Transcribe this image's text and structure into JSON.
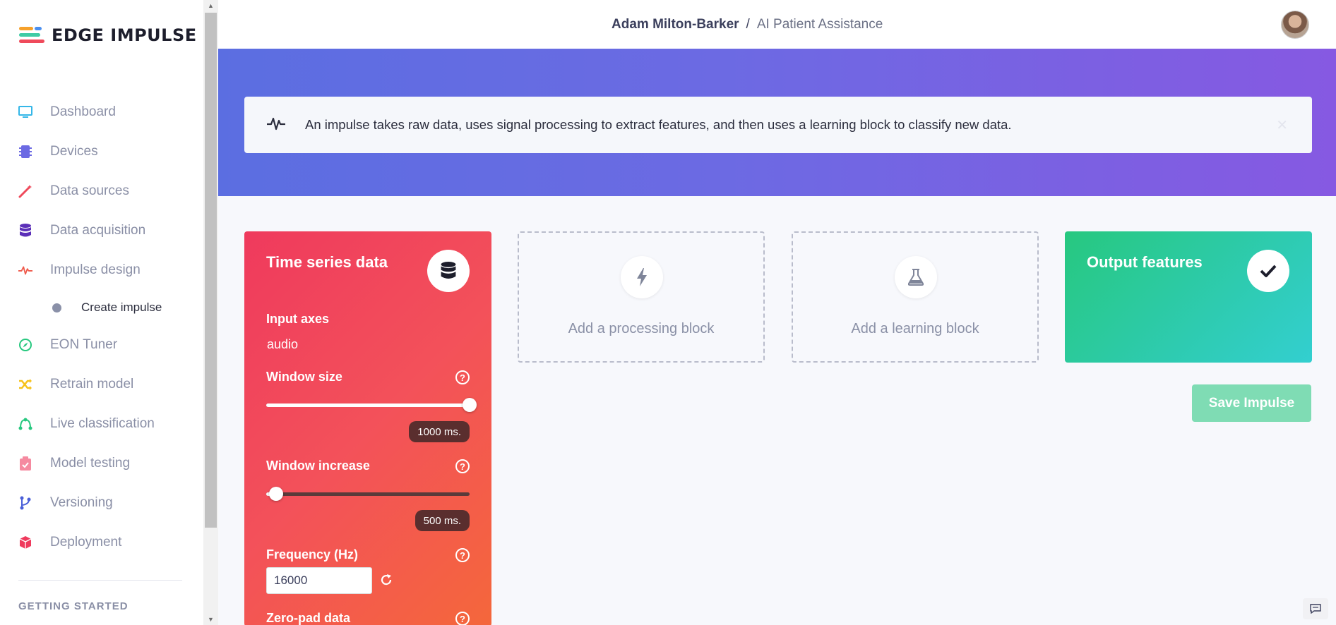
{
  "brand": {
    "name": "EDGE IMPULSE",
    "logo_colors": [
      "#ef4a5b",
      "#f6a12b",
      "#3ecba5",
      "#4a8ff0"
    ]
  },
  "sidebar": {
    "items": [
      {
        "label": "Dashboard",
        "icon": "monitor-icon",
        "color": "#35b7e8"
      },
      {
        "label": "Devices",
        "icon": "chip-icon",
        "color": "#6c6ae3"
      },
      {
        "label": "Data sources",
        "icon": "wand-icon",
        "color": "#ef4a5b"
      },
      {
        "label": "Data acquisition",
        "icon": "database-icon",
        "color": "#5b2fb8"
      },
      {
        "label": "Impulse design",
        "icon": "pulse-icon",
        "color": "#ef5a4b"
      },
      {
        "label": "EON Tuner",
        "icon": "compass-icon",
        "color": "#27c87f"
      },
      {
        "label": "Retrain model",
        "icon": "shuffle-icon",
        "color": "#f6c21b"
      },
      {
        "label": "Live classification",
        "icon": "bezier-icon",
        "color": "#27c87f"
      },
      {
        "label": "Model testing",
        "icon": "clipboard-check-icon",
        "color": "#f58aa0"
      },
      {
        "label": "Versioning",
        "icon": "branch-icon",
        "color": "#4a5fd8"
      },
      {
        "label": "Deployment",
        "icon": "cube-icon",
        "color": "#ef3a5d"
      }
    ],
    "sub_item": {
      "label": "Create impulse"
    },
    "section_heading": "GETTING STARTED"
  },
  "header": {
    "owner": "Adam Milton-Barker",
    "separator": "/",
    "project": "AI Patient Assistance"
  },
  "info_banner": {
    "text": "An impulse takes raw data, uses signal processing to extract features, and then uses a learning block to classify new data.",
    "close_icon": "close-icon"
  },
  "time_series": {
    "title": "Time series data",
    "icon": "database-icon",
    "input_axes_label": "Input axes",
    "input_axes_value": "audio",
    "window_size_label": "Window size",
    "window_size_value": "1000 ms.",
    "window_size_fraction": 1.0,
    "window_increase_label": "Window increase",
    "window_increase_value": "500 ms.",
    "window_increase_fraction": 0.05,
    "frequency_label": "Frequency (Hz)",
    "frequency_value": "16000",
    "zero_pad_label": "Zero-pad data"
  },
  "processing_block": {
    "label": "Add a processing block",
    "icon": "bolt-icon"
  },
  "learning_block": {
    "label": "Add a learning block",
    "icon": "flask-icon"
  },
  "output_features": {
    "title": "Output features",
    "icon": "check-icon"
  },
  "save_button": {
    "label": "Save Impulse"
  }
}
